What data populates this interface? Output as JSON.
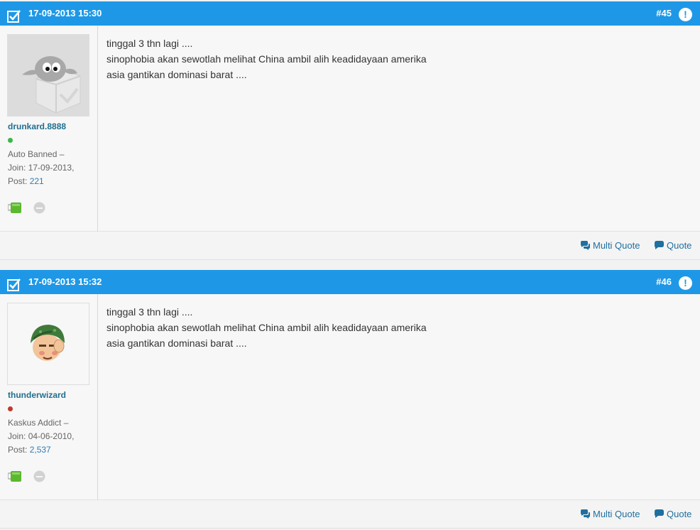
{
  "posts": [
    {
      "date": "17-09-2013 15:30",
      "number": "#45",
      "username": "drunkard.8888",
      "status_color": "#3cb64a",
      "rank": "Auto Banned",
      "join_label": "Join:",
      "join_date": "17-09-2013,",
      "post_label": "Post:",
      "post_count": "221",
      "content": [
        "tinggal 3 thn lagi ....",
        "sinophobia akan sewotlah melihat China ambil alih keadidayaan amerika",
        "asia gantikan dominasi barat ...."
      ],
      "avatar_icon": "default-avatar-icon"
    },
    {
      "date": "17-09-2013 15:32",
      "number": "#46",
      "username": "thunderwizard",
      "status_color": "#c0392b",
      "rank": "Kaskus Addict",
      "join_label": "Join:",
      "join_date": "04-06-2010,",
      "post_label": "Post:",
      "post_count": "2,537",
      "content": [
        "tinggal 3 thn lagi ....",
        "sinophobia akan sewotlah melihat China ambil alih keadidayaan amerika",
        "asia gantikan dominasi barat ...."
      ],
      "avatar_icon": "soldier-avatar-icon"
    }
  ],
  "footer": {
    "multi_quote_label": "Multi Quote",
    "quote_label": "Quote"
  },
  "colors": {
    "header_blue": "#1e98e6",
    "link_blue": "#1f6f9f"
  }
}
